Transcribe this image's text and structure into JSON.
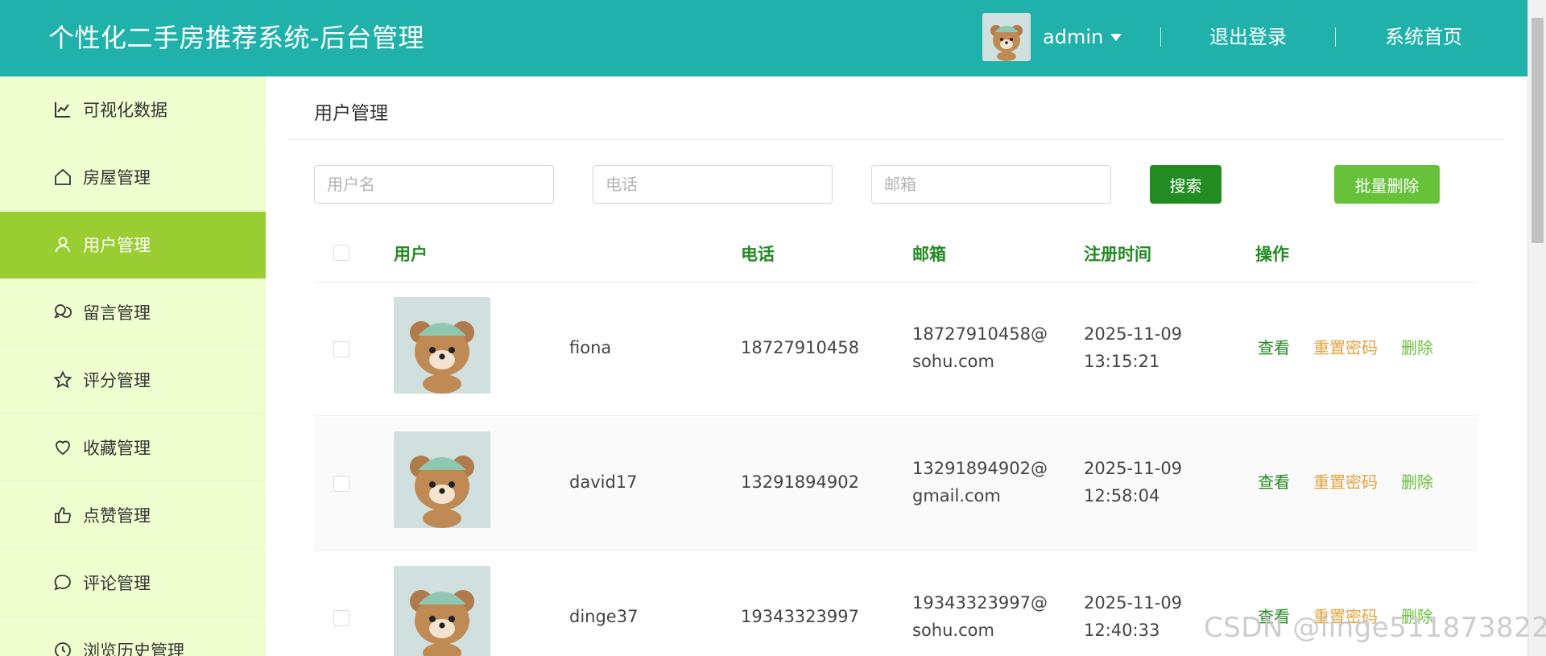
{
  "header": {
    "title": "个性化二手房推荐系统-后台管理",
    "user": "admin",
    "logout": "退出登录",
    "home": "系统首页"
  },
  "sidebar": {
    "items": [
      {
        "label": "可视化数据",
        "icon": "chart-icon"
      },
      {
        "label": "房屋管理",
        "icon": "home-icon"
      },
      {
        "label": "用户管理",
        "icon": "user-icon",
        "active": true
      },
      {
        "label": "留言管理",
        "icon": "message-icon"
      },
      {
        "label": "评分管理",
        "icon": "star-icon"
      },
      {
        "label": "收藏管理",
        "icon": "heart-icon"
      },
      {
        "label": "点赞管理",
        "icon": "thumbs-up-icon"
      },
      {
        "label": "评论管理",
        "icon": "comment-icon"
      },
      {
        "label": "浏览历史管理",
        "icon": "clock-icon"
      }
    ]
  },
  "main": {
    "title": "用户管理",
    "filters": {
      "username_placeholder": "用户名",
      "phone_placeholder": "电话",
      "email_placeholder": "邮箱"
    },
    "search_label": "搜索",
    "batch_delete_label": "批量删除",
    "table": {
      "columns": [
        "用户",
        "电话",
        "邮箱",
        "注册时间",
        "操作"
      ],
      "rows": [
        {
          "username": "fiona",
          "phone": "18727910458",
          "email": "18727910458@sohu.com",
          "created": "2025-11-09 13:15:21"
        },
        {
          "username": "david17",
          "phone": "13291894902",
          "email": "13291894902@gmail.com",
          "created": "2025-11-09 12:58:04"
        },
        {
          "username": "dinge37",
          "phone": "19343323997",
          "email": "19343323997@sohu.com",
          "created": "2025-11-09 12:40:33"
        }
      ],
      "actions": {
        "view": "查看",
        "reset": "重置密码",
        "delete": "删除"
      }
    }
  },
  "watermark": "CSDN @linge511873822",
  "colors": {
    "header": "#20b2aa",
    "sidebar": "#f0ffd0",
    "active": "#9acd32",
    "primary": "#228b22",
    "warning": "#e6a23c",
    "success": "#67c23a"
  }
}
